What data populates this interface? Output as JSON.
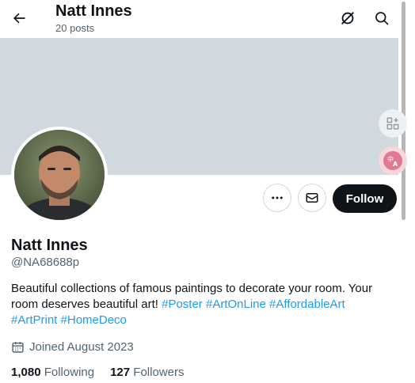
{
  "header": {
    "name": "Natt Innes",
    "posts": "20 posts"
  },
  "profile": {
    "display_name": "Natt Innes",
    "handle": "@NA68688p",
    "bio_text": "Beautiful collections of famous paintings to decorate your room. Your room deserves beautiful art!",
    "bio_tags": [
      "#Poster",
      "#ArtOnLine",
      "#AffordableArt",
      "#ArtPrint",
      "#HomeDeco"
    ],
    "joined": "Joined August 2023",
    "following_count": "1,080",
    "following_label": "Following",
    "followers_count": "127",
    "followers_label": "Followers"
  },
  "actions": {
    "follow_label": "Follow"
  },
  "icons": {
    "back": "arrow-left-icon",
    "spaces": "hide-icon",
    "search": "search-icon",
    "more": "more-icon",
    "message": "mail-icon",
    "calendar": "calendar-icon",
    "side_tool_1": "apps-icon",
    "side_tool_2": "translate-icon"
  },
  "colors": {
    "banner": "#cfd9de",
    "accent": "#1d9bf0",
    "follow_button": "#0f1419"
  }
}
